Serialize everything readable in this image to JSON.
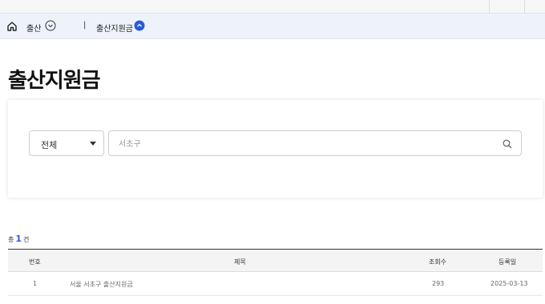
{
  "breadcrumb": {
    "item1": "출산",
    "separator": "|",
    "item2": "출산지원금"
  },
  "page": {
    "title": "출산지원금"
  },
  "search": {
    "select_value": "전체",
    "placeholder": "서초구"
  },
  "results": {
    "prefix": "총",
    "count": "1",
    "suffix": "건"
  },
  "table": {
    "headers": {
      "no": "번호",
      "title": "제목",
      "views": "조회수",
      "date": "등록일"
    },
    "rows": [
      {
        "no": "1",
        "title": "서울 서초구 출산지원금",
        "views": "293",
        "date": "2025-03-13"
      }
    ]
  },
  "colors": {
    "accent": "#2a5bd7",
    "breadcrumb_bg": "#eef2fb"
  }
}
